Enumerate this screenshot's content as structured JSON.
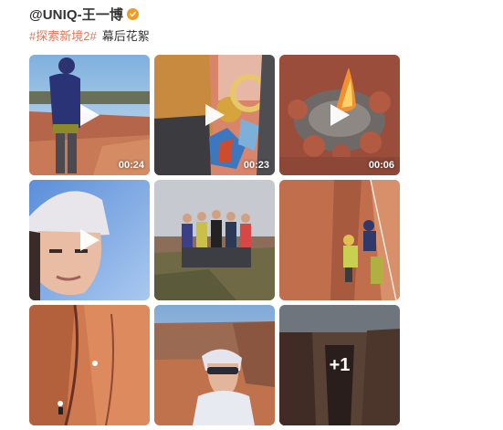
{
  "post": {
    "author": "@UNIQ-王一博",
    "verified_icon": "verified-badge-icon",
    "tag": "#探索新境2#",
    "tag_suffix": "幕后花絮",
    "colors": {
      "tag": "#eb7350",
      "badge": "#f59b1c",
      "author": "#333333"
    }
  },
  "media": [
    {
      "type": "video",
      "duration": "00:24",
      "icon": "play-icon"
    },
    {
      "type": "video",
      "duration": "00:23",
      "icon": "play-icon"
    },
    {
      "type": "video",
      "duration": "00:06",
      "icon": "play-icon"
    },
    {
      "type": "video",
      "duration": "",
      "icon": "play-icon"
    },
    {
      "type": "image"
    },
    {
      "type": "image"
    },
    {
      "type": "image"
    },
    {
      "type": "image"
    },
    {
      "type": "image",
      "more_count": "+1"
    }
  ]
}
